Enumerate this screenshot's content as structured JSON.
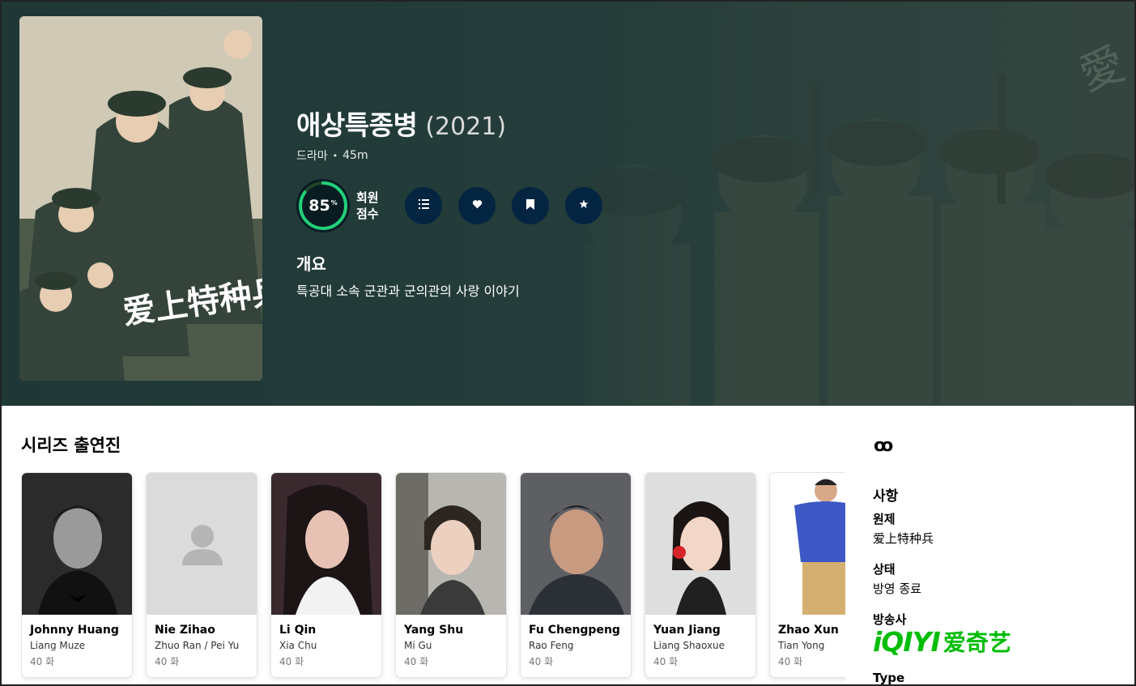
{
  "show": {
    "title": "애상특종병",
    "year": "(2021)",
    "genre": "드라마",
    "separator": "•",
    "runtime": "45m",
    "score_value": "85",
    "score_unit": "%",
    "score_percent": 85,
    "score_label_line1": "회원",
    "score_label_line2": "점수",
    "overview_heading": "개요",
    "overview": "특공대 소속 군관과 군의관의 사랑 이야기"
  },
  "poster": {
    "title_art": "爱上特种兵"
  },
  "actions": [
    {
      "name": "add-to-list",
      "icon": "list-icon",
      "glyph": "☰"
    },
    {
      "name": "favorite",
      "icon": "heart-icon",
      "glyph": "♥"
    },
    {
      "name": "watchlist",
      "icon": "bookmark-icon",
      "glyph": "🔖"
    },
    {
      "name": "rate",
      "icon": "star-icon",
      "glyph": "★"
    }
  ],
  "cast": {
    "heading": "시리즈 출연진",
    "members": [
      {
        "name": "Johnny Huang",
        "role": "Liang Muze",
        "episodes": "40 화"
      },
      {
        "name": "Nie Zihao",
        "role": "Zhuo Ran / Pei Yu",
        "episodes": "40 화"
      },
      {
        "name": "Li Qin",
        "role": "Xia Chu",
        "episodes": "40 화"
      },
      {
        "name": "Yang Shu",
        "role": "Mi Gu",
        "episodes": "40 화"
      },
      {
        "name": "Fu Chengpeng",
        "role": "Rao Feng",
        "episodes": "40 화"
      },
      {
        "name": "Yuan Jiang",
        "role": "Liang Shaoxue",
        "episodes": "40 화"
      },
      {
        "name": "Zhao Xun",
        "role": "Tian Yong",
        "episodes": "40 화"
      }
    ]
  },
  "sidebar": {
    "link_icon": "ꝏ",
    "facts_heading": "사항",
    "original_title_label": "원제",
    "original_title": "爱上特种兵",
    "status_label": "상태",
    "status": "방영 종료",
    "network_label": "방송사",
    "network_logo_latin": "iQIYI",
    "network_logo_cn": "爱奇艺",
    "type_label": "Type"
  },
  "colors": {
    "hero_bg": "#233c3a",
    "score_ring": "#21d07a",
    "action_button": "#032541",
    "network_green": "#00be06"
  }
}
